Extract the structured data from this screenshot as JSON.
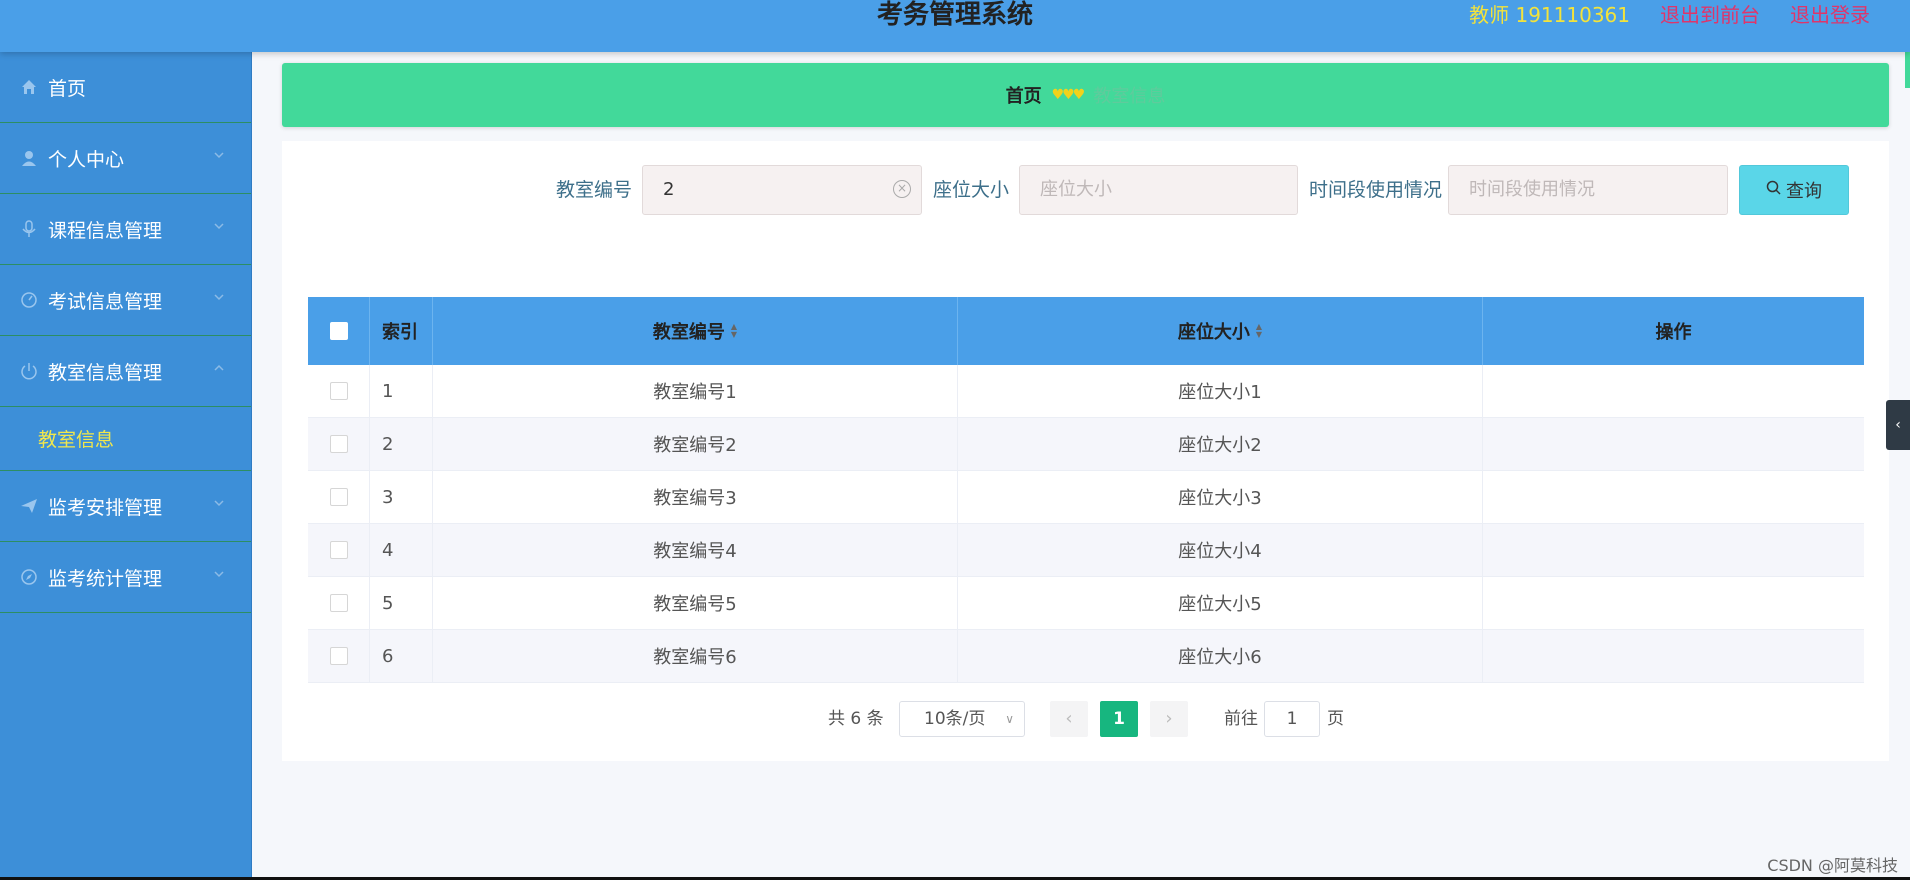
{
  "header": {
    "title": "考务管理系统",
    "user": "教师 191110361",
    "to_front": "退出到前台",
    "logout": "退出登录"
  },
  "sidebar": {
    "items": [
      {
        "label": "首页",
        "icon": "home-icon"
      },
      {
        "label": "个人中心",
        "icon": "user-icon"
      },
      {
        "label": "课程信息管理",
        "icon": "mic-icon"
      },
      {
        "label": "考试信息管理",
        "icon": "gauge-icon"
      },
      {
        "label": "教室信息管理",
        "icon": "power-icon"
      },
      {
        "label": "监考安排管理",
        "icon": "send-icon"
      },
      {
        "label": "监考统计管理",
        "icon": "compass-icon"
      }
    ],
    "submenu_label": "教室信息"
  },
  "breadcrumb": {
    "home": "首页",
    "separator": "♥♥♥",
    "current": "教室信息"
  },
  "search": {
    "code_label": "教室编号",
    "code_value": "2",
    "seat_label": "座位大小",
    "seat_placeholder": "座位大小",
    "time_label": "时间段使用情况",
    "time_placeholder": "时间段使用情况",
    "button_label": "查询"
  },
  "table": {
    "headers": {
      "index": "索引",
      "code": "教室编号",
      "seat": "座位大小",
      "op": "操作"
    },
    "rows": [
      {
        "idx": "1",
        "code": "教室编号1",
        "seat": "座位大小1"
      },
      {
        "idx": "2",
        "code": "教室编号2",
        "seat": "座位大小2"
      },
      {
        "idx": "3",
        "code": "教室编号3",
        "seat": "座位大小3"
      },
      {
        "idx": "4",
        "code": "教室编号4",
        "seat": "座位大小4"
      },
      {
        "idx": "5",
        "code": "教室编号5",
        "seat": "座位大小5"
      },
      {
        "idx": "6",
        "code": "教室编号6",
        "seat": "座位大小6"
      }
    ]
  },
  "pagination": {
    "total": "共 6 条",
    "page_size": "10条/页",
    "prev": "‹",
    "current": "1",
    "next": "›",
    "goto_label": "前往",
    "goto_value": "1",
    "page_suffix": "页"
  },
  "side_tab": "‹",
  "watermark": "CSDN @阿莫科技",
  "colors": {
    "header": "#4a9fe8",
    "sidebar": "#3d8fd8",
    "breadcrumb": "#42d99a",
    "active_page": "#17b67f",
    "search_button": "#5ad6e8"
  }
}
